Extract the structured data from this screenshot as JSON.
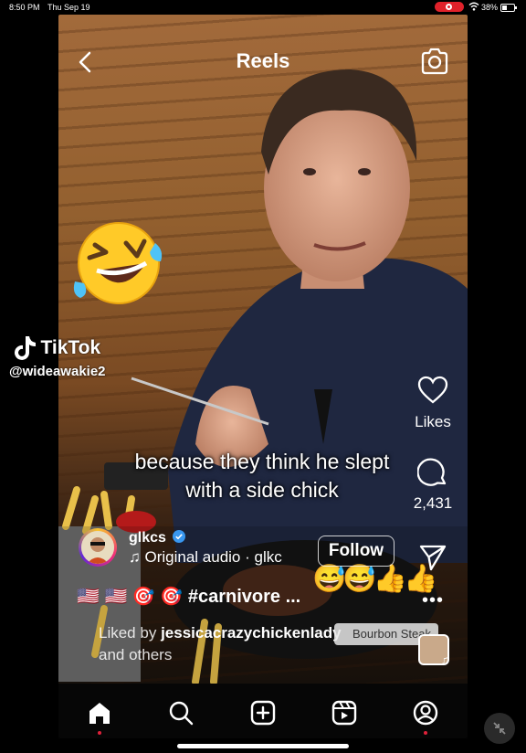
{
  "status_bar": {
    "time": "8:50 PM",
    "date": "Thu Sep 19",
    "battery": "38%"
  },
  "header": {
    "title": "Reels"
  },
  "watermark": {
    "logo_text": "TikTok",
    "handle": "@wideawakie2"
  },
  "caption": {
    "line1": "because they think he slept",
    "line2": "with a side chick"
  },
  "actions": {
    "likes_label": "Likes",
    "comments_count": "2,431"
  },
  "post": {
    "username": "glkcs",
    "audio": "Original audio · glkc",
    "follow_label": "Follow",
    "tags": "🇺🇸 🇺🇸 🎯 🎯 #carnivore ...",
    "liked_by_prefix": "Liked by",
    "liked_by_user": "jessicacrazychickenlady",
    "liked_by_suffix": "and others",
    "product_chip": "Bourbon Steak"
  },
  "overlay_emojis": "😅😅👍👍",
  "big_emoji": "🤣",
  "icons": [
    "back-icon",
    "camera-icon",
    "heart-icon",
    "comment-icon",
    "share-icon",
    "more-icon",
    "home-icon",
    "search-icon",
    "create-icon",
    "reels-icon",
    "profile-icon",
    "verified-icon",
    "music-note-icon"
  ],
  "colors": {
    "nav_bg": "#060606",
    "notification_dot": "#e0213a",
    "record": "#e0212a"
  }
}
